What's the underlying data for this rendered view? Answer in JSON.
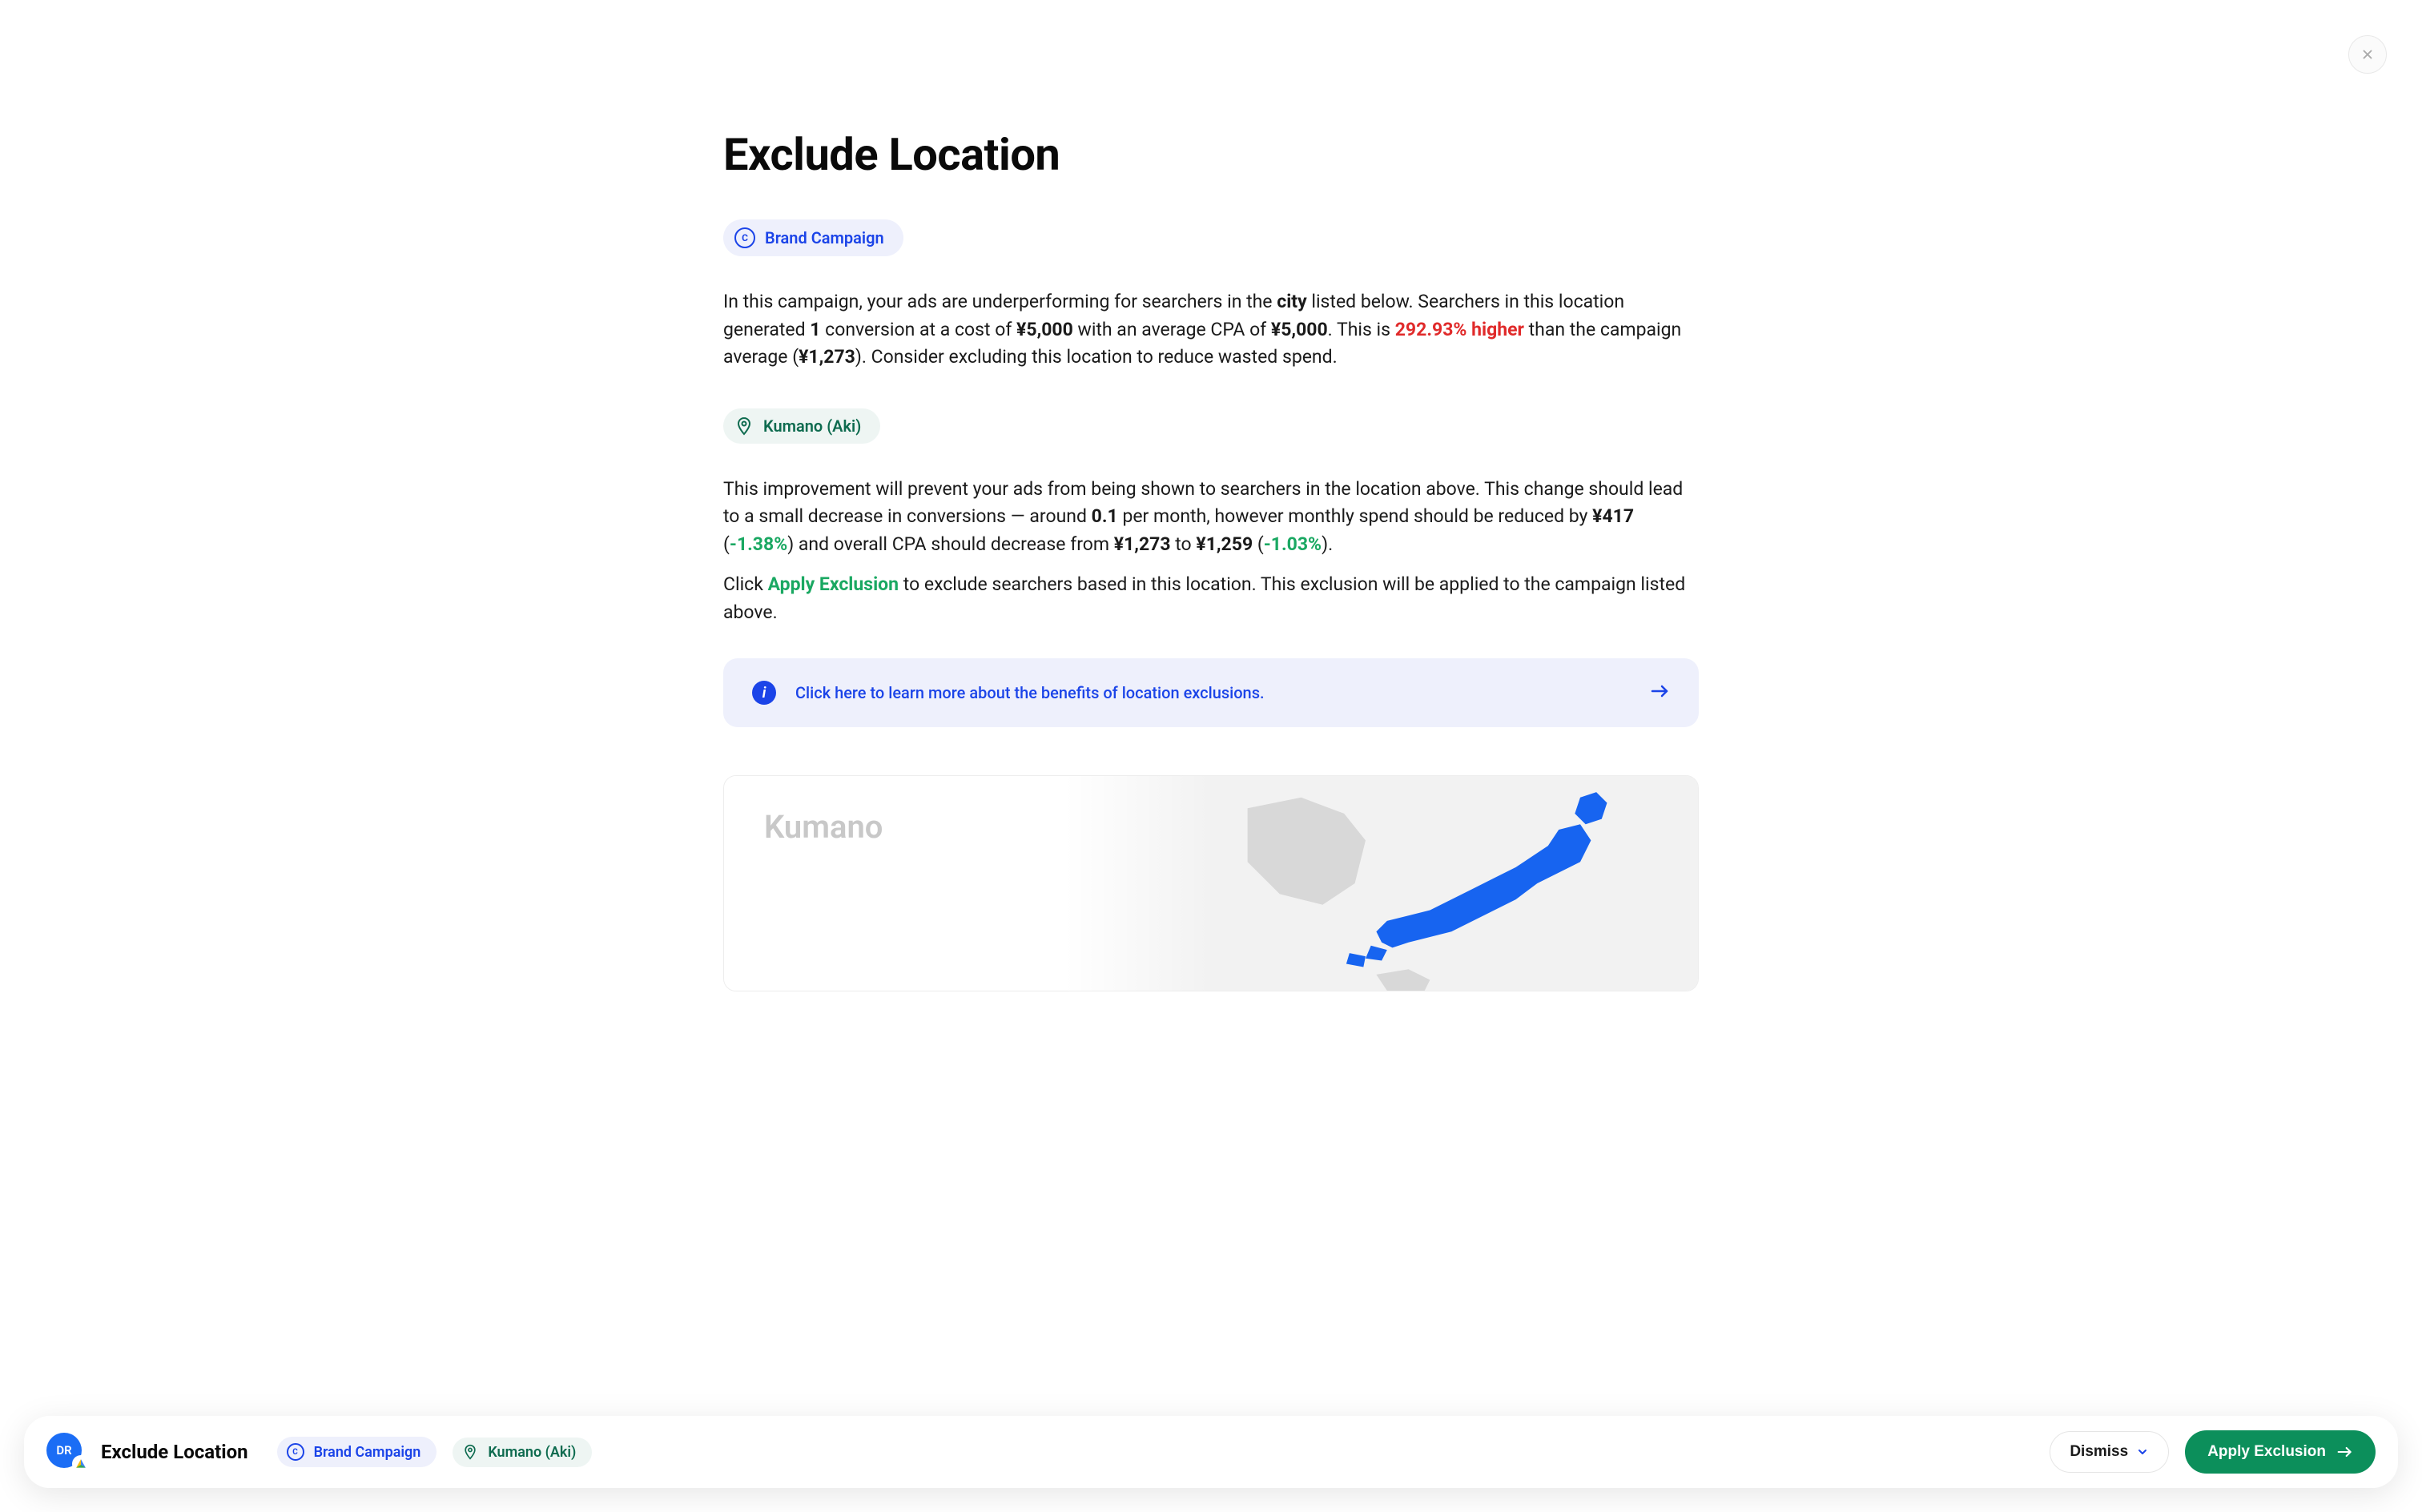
{
  "header": {
    "title": "Exclude Location"
  },
  "campaign": {
    "name": "Brand Campaign",
    "icon_letter": "C"
  },
  "location": {
    "name": "Kumano (Aki)"
  },
  "paragraph1": {
    "part1": "In this campaign, your ads are underperforming for searchers in the ",
    "bold_city": "city",
    "part2": " listed below. Searchers in this location generated ",
    "bold_conversions": "1",
    "part3": " conversion at a cost of ",
    "bold_cost": "¥5,000",
    "part4": " with an average CPA of ",
    "bold_cpa": "¥5,000",
    "part5": ". This is ",
    "red_percent": "292.93% higher",
    "part6": " than the campaign average (",
    "bold_avg": "¥1,273",
    "part7": "). Consider excluding this location to reduce wasted spend."
  },
  "paragraph2": {
    "part1": "This improvement will prevent your ads from being shown to searchers in the location above. This change should lead to a small decrease in conversions — around ",
    "bold_decrease": "0.1",
    "part2": " per month, however monthly spend should be reduced by ",
    "bold_spend": "¥417",
    "part3": " (",
    "green_spend_pct": "-1.38%",
    "part4": ") and overall CPA should decrease from ",
    "bold_from": "¥1,273",
    "part5": " to ",
    "bold_to": "¥1,259",
    "part6": " (",
    "green_cpa_pct": "-1.03%",
    "part7": ")."
  },
  "paragraph3": {
    "part1": "Click ",
    "apply_text": "Apply Exclusion",
    "part2": " to exclude searchers based in this location. This exclusion will be applied to the campaign listed above."
  },
  "info_banner": {
    "text": "Click here to learn more about the benefits of location exclusions.",
    "icon_letter": "i"
  },
  "map": {
    "label": "Kumano"
  },
  "bottom_bar": {
    "avatar_initials": "DR",
    "title": "Exclude Location",
    "campaign": "Brand Campaign",
    "location": "Kumano (Aki)",
    "dismiss_label": "Dismiss",
    "apply_label": "Apply Exclusion"
  }
}
